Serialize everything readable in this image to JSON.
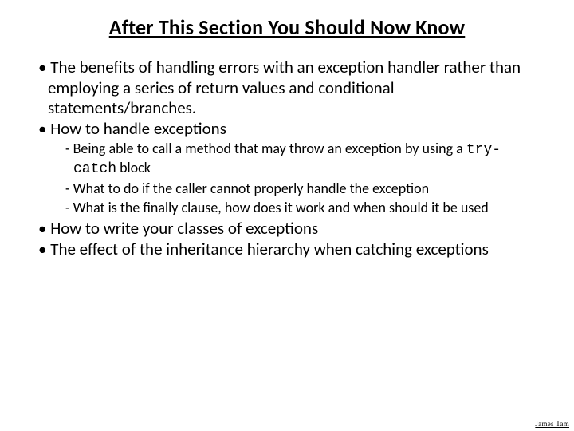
{
  "title": "After This Section You Should Now Know",
  "bullets": {
    "b1": "The benefits of handling errors with an exception handler rather than employing a series of return values and conditional statements/branches.",
    "b2": "How to handle exceptions",
    "b2_sub1_pre": "Being able to call a method that may throw an exception by using a ",
    "b2_sub1_code": "try-catch",
    "b2_sub1_post": " block",
    "b2_sub2": "What to do if the caller cannot properly handle the exception",
    "b2_sub3": "What is the finally clause, how does it work and when should it be used",
    "b3": "How to write your classes of exceptions",
    "b4": "The effect of the inheritance hierarchy when catching exceptions"
  },
  "footer": "James Tam"
}
